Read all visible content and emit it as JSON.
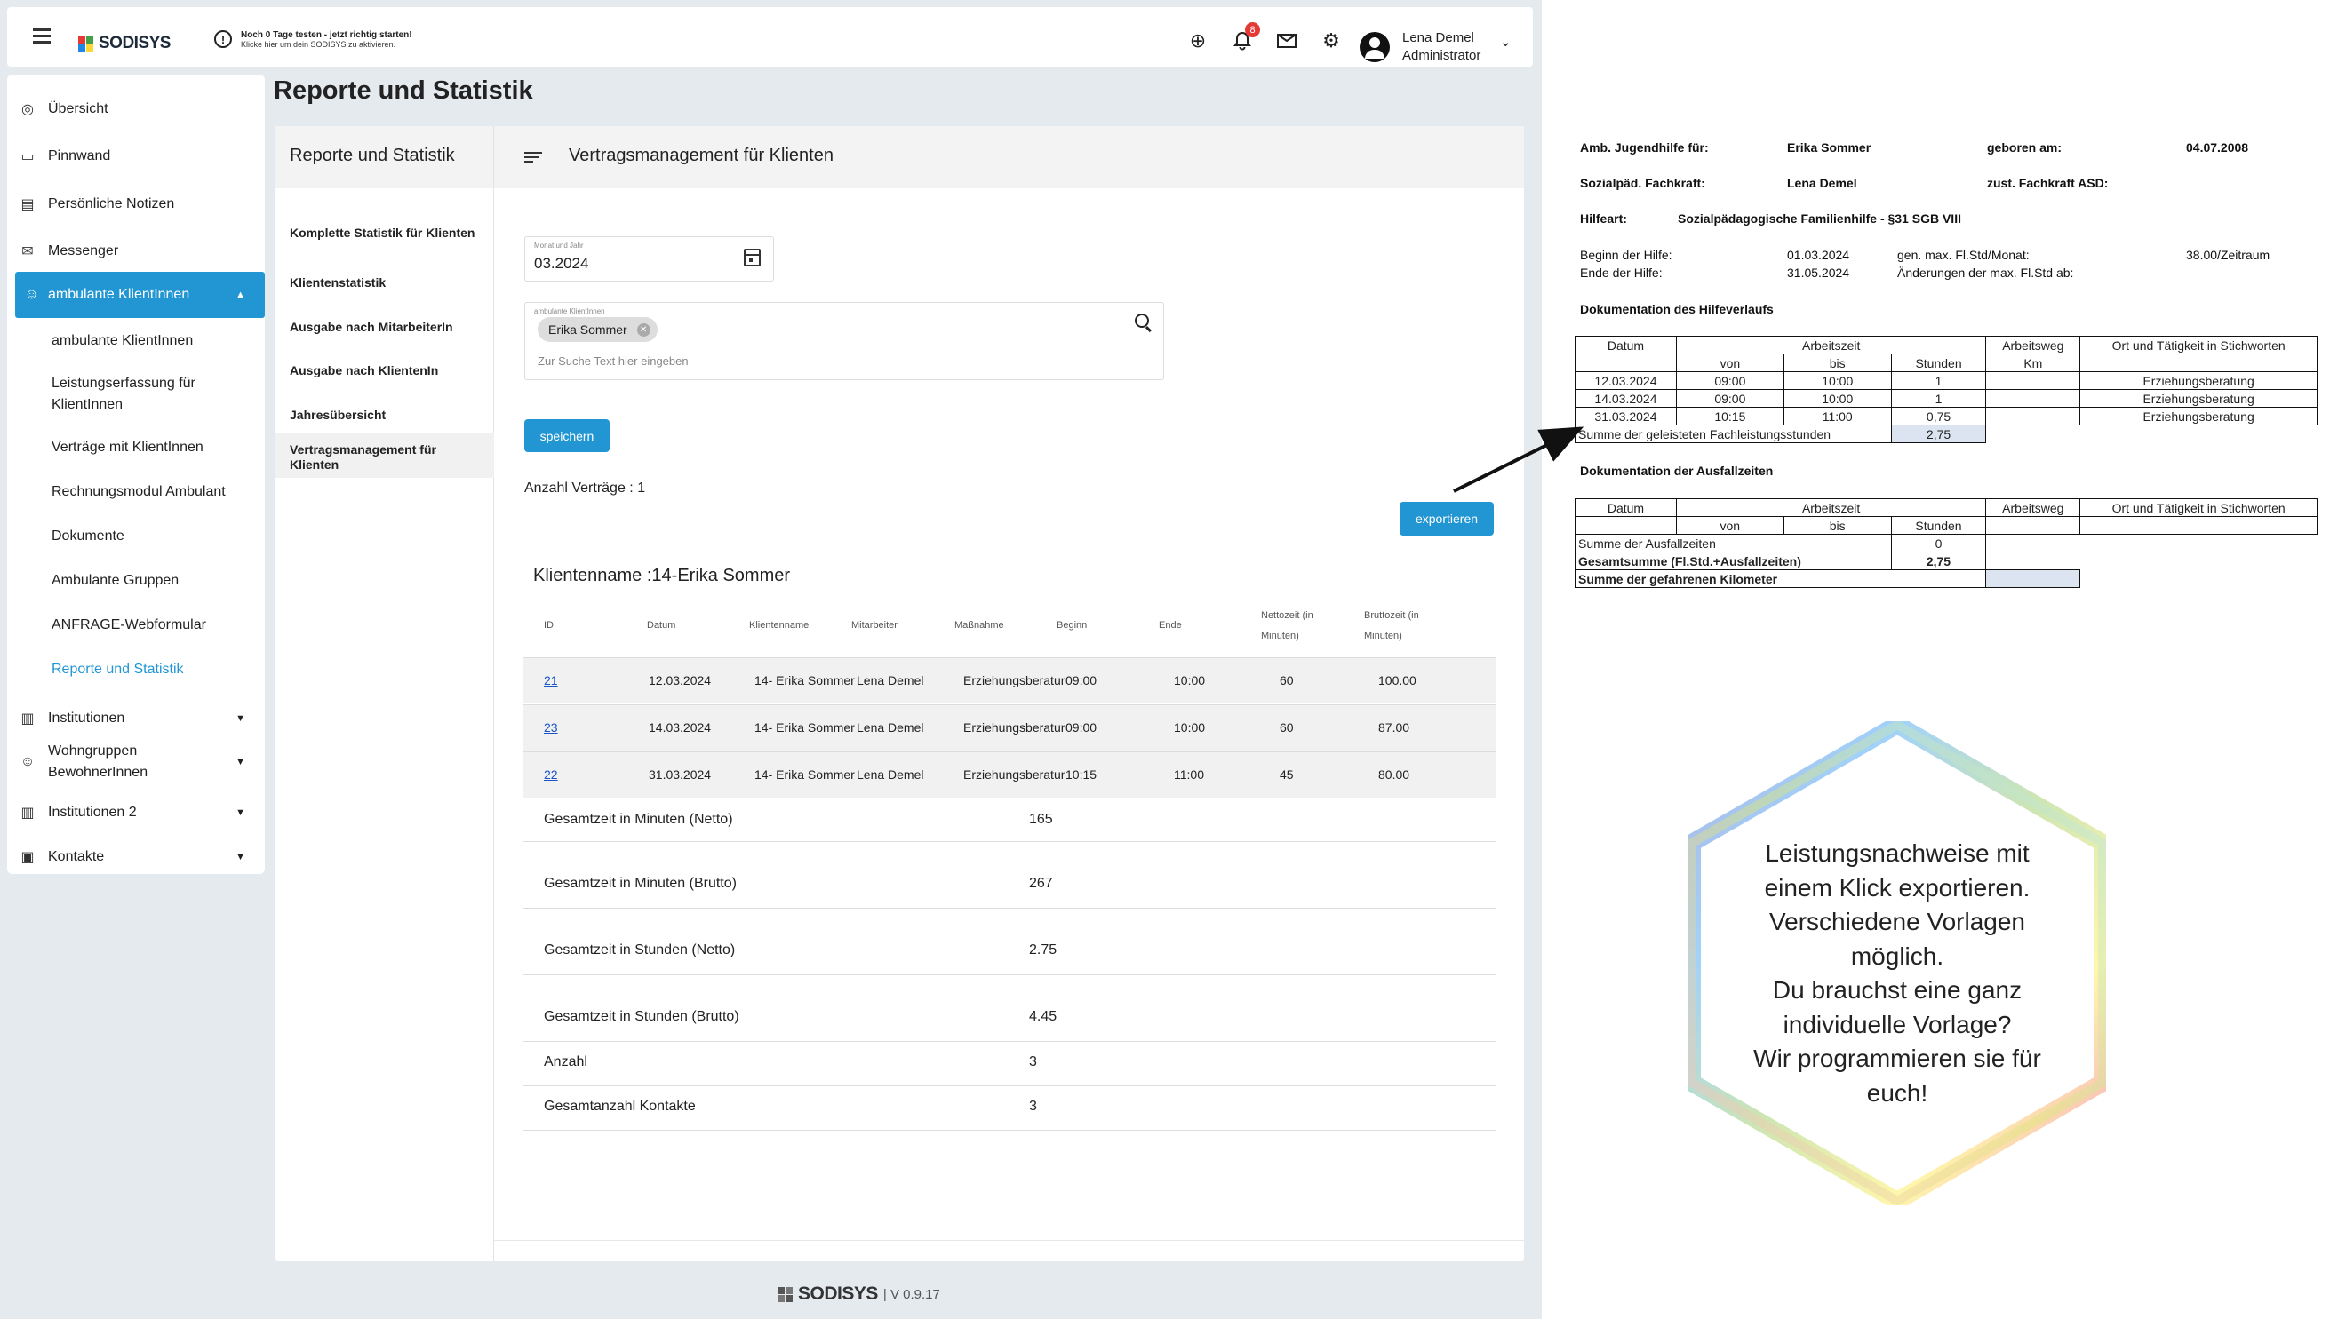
{
  "topbar": {
    "brand": "SODISYS",
    "notice_title": "Noch 0 Tage testen - jetzt richtig starten!",
    "notice_sub": "Klicke hier um dein SODISYS zu aktivieren.",
    "notification_count": "8",
    "user_name": "Lena Demel",
    "user_role": "Administrator"
  },
  "sidebar": {
    "items": [
      {
        "label": "Übersicht",
        "icon": "compass-icon"
      },
      {
        "label": "Pinnwand",
        "icon": "forum-icon"
      },
      {
        "label": "Persönliche Notizen",
        "icon": "note-icon"
      },
      {
        "label": "Messenger",
        "icon": "mail-icon"
      },
      {
        "label": "ambulante KlientInnen",
        "icon": "smiley-icon"
      }
    ],
    "sub_items": [
      "ambulante KlientInnen",
      "Leistungserfassung für KlientInnen",
      "Verträge mit KlientInnen",
      "Rechnungsmodul Ambulant",
      "Dokumente",
      "Ambulante Gruppen",
      "ANFRAGE-Webformular",
      "Reporte und Statistik"
    ],
    "groups": [
      {
        "label": "Institutionen",
        "icon": "building-icon"
      },
      {
        "label": "Wohngruppen BewohnerInnen",
        "icon": "smiley-icon"
      },
      {
        "label": "Institutionen 2",
        "icon": "building-icon"
      },
      {
        "label": "Kontakte",
        "icon": "contact-icon"
      }
    ]
  },
  "page": {
    "title": "Reporte und Statistik"
  },
  "reports": {
    "header": "Reporte und Statistik",
    "links": [
      "Komplette Statistik für Klienten",
      "Klientenstatistik",
      "Ausgabe nach MitarbeiterIn",
      "Ausgabe nach KlientenIn",
      "Jahresübersicht",
      "Vertragsmanagement für Klienten"
    ]
  },
  "contract": {
    "title": "Vertragsmanagement für Klienten",
    "month_label": "Monat und Jahr",
    "month_value": "03.2024",
    "client_label": "ambulante KlientInnen",
    "client_chip": "Erika Sommer",
    "search_placeholder": "Zur Suche Text hier eingeben",
    "save_label": "speichern",
    "count_text": "Anzahl Verträge : 1",
    "export_label": "exportieren",
    "client_name": "Klientenname :14-Erika Sommer",
    "columns": [
      "ID",
      "Datum",
      "Klientenname",
      "Mitarbeiter",
      "Maßnahme",
      "Beginn",
      "Ende",
      "Nettozeit (in Minuten)",
      "Bruttozeit (in Minuten)"
    ],
    "rows": [
      [
        "21",
        "12.03.2024",
        "14- Erika Sommer",
        "Lena Demel",
        "Erziehungsberatung",
        "09:00",
        "10:00",
        "60",
        "100.00"
      ],
      [
        "23",
        "14.03.2024",
        "14- Erika Sommer",
        "Lena Demel",
        "Erziehungsberatung",
        "09:00",
        "10:00",
        "60",
        "87.00"
      ],
      [
        "22",
        "31.03.2024",
        "14- Erika Sommer",
        "Lena Demel",
        "Erziehungsberatung",
        "10:15",
        "11:00",
        "45",
        "80.00"
      ]
    ],
    "summary": [
      {
        "label": "Gesamtzeit in Minuten (Netto)",
        "value": "165"
      },
      {
        "label": "Gesamtzeit in Minuten (Brutto)",
        "value": "267"
      },
      {
        "label": "Gesamtzeit in Stunden (Netto)",
        "value": "2.75"
      },
      {
        "label": "Gesamtzeit in Stunden (Brutto)",
        "value": "4.45"
      },
      {
        "label": "Anzahl",
        "value": "3"
      },
      {
        "label": "Gesamtanzahl Kontakte",
        "value": "3"
      }
    ]
  },
  "footer": {
    "brand": "SODISYS",
    "version": "| V 0.9.17"
  },
  "document": {
    "lbl_help_for": "Amb. Jugendhilfe für:",
    "val_help_for": "Erika Sommer",
    "lbl_born": "geboren am:",
    "val_born": "04.07.2008",
    "lbl_specialist": "Sozialpäd. Fachkraft:",
    "val_specialist": "Lena Demel",
    "lbl_asd": "zust. Fachkraft ASD:",
    "lbl_type": "Hilfeart:",
    "val_type": "Sozialpädagogische Familienhilfe - §31 SGB VIII",
    "lbl_begin": "Beginn der Hilfe:",
    "val_begin": "01.03.2024",
    "lbl_end": "Ende der Hilfe:",
    "val_end": "31.05.2024",
    "lbl_max": "gen. max. Fl.Std/Monat:",
    "val_max": "38.00/Zeitraum",
    "lbl_changes": "Änderungen der max. Fl.Std ab:",
    "sec1": "Dokumentation des Hilfeverlaufs",
    "sec2": "Dokumentation der Ausfallzeiten",
    "h_datum": "Datum",
    "h_arbeitszeit": "Arbeitszeit",
    "h_arbeitsweg": "Arbeitsweg",
    "h_ort": "Ort und Tätigkeit in Stichworten",
    "h_von": "von",
    "h_bis": "bis",
    "h_stunden": "Stunden",
    "h_km": "Km",
    "rows": [
      [
        "12.03.2024",
        "09:00",
        "10:00",
        "1",
        "Erziehungsberatung"
      ],
      [
        "14.03.2024",
        "09:00",
        "10:00",
        "1",
        "Erziehungsberatung"
      ],
      [
        "31.03.2024",
        "10:15",
        "11:00",
        "0,75",
        "Erziehungsberatung"
      ]
    ],
    "sum_label": "Summe der geleisteten Fachleistungsstunden",
    "sum_value": "2,75",
    "sum_ausfall_label": "Summe der Ausfallzeiten",
    "sum_ausfall_value": "0",
    "gesamt_label": "Gesamtsumme (Fl.Std.+Ausfallzeiten)",
    "gesamt_value": "2,75",
    "km_label": "Summe der gefahrenen Kilometer"
  },
  "promo": {
    "text": "Leistungsnachweise mit einem Klick exportieren. Verschiedene Vorlagen möglich. Du brauchst eine ganz individuelle Vorlage? Wir programmieren sie für euch!",
    "lines": [
      "Leistungsnachweise mit",
      "einem Klick exportieren.",
      "Verschiedene Vorlagen",
      "möglich.",
      "Du brauchst eine ganz",
      "individuelle Vorlage?",
      "Wir programmieren sie für",
      "euch!"
    ]
  }
}
